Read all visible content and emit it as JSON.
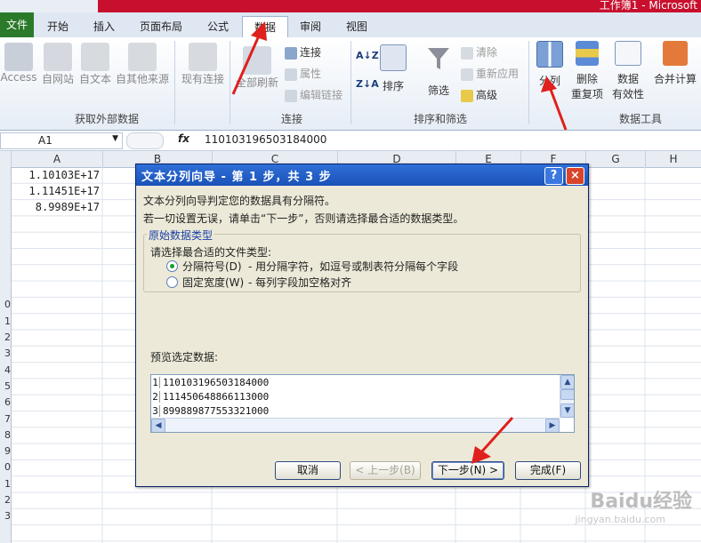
{
  "window": {
    "title_fragment": "工作簿1 - Microsoft"
  },
  "tabs": [
    {
      "label": "文件"
    },
    {
      "label": "开始"
    },
    {
      "label": "插入"
    },
    {
      "label": "页面布局"
    },
    {
      "label": "公式"
    },
    {
      "label": "数据"
    },
    {
      "label": "审阅"
    },
    {
      "label": "视图"
    }
  ],
  "active_tab": "数据",
  "ribbon": {
    "external": {
      "buttons": [
        "Access",
        "自网站",
        "自文本",
        "自其他来源",
        "现有连接"
      ],
      "group_label": "获取外部数据"
    },
    "connections": {
      "refresh_all": "全部刷新",
      "connections": "连接",
      "properties": "属性",
      "edit_links": "编辑链接",
      "group_label": "连接"
    },
    "sort_filter": {
      "sort": "排序",
      "filter": "筛选",
      "clear": "清除",
      "reapply": "重新应用",
      "advanced": "高级",
      "group_label": "排序和筛选"
    },
    "data_tools": {
      "text_to_columns": "分列",
      "remove_duplicates_1": "删除",
      "remove_duplicates_2": "重复项",
      "data_validation_1": "数据",
      "data_validation_2": "有效性",
      "consolidate": "合并计算",
      "group_label": "数据工具"
    }
  },
  "formula_bar": {
    "name_box": "A1",
    "fx": "fx",
    "formula": "110103196503184000"
  },
  "grid": {
    "columns": [
      "A",
      "B",
      "C",
      "D",
      "E",
      "F",
      "G",
      "H"
    ],
    "rows": [
      "",
      "",
      "",
      "",
      "",
      "",
      "",
      "",
      "0",
      "1",
      "2",
      "3",
      "4",
      "5",
      "6",
      "7",
      "8",
      "9",
      "0",
      "1",
      "2",
      "3"
    ],
    "cells": [
      "1.10103E+17",
      "1.11451E+17",
      "8.9989E+17"
    ]
  },
  "dialog": {
    "title": "文本分列向导 - 第 1 步，共 3 步",
    "help": "?",
    "close": "×",
    "line1": "文本分列向导判定您的数据具有分隔符。",
    "line2": "若一切设置无误，请单击“下一步”，否则请选择最合适的数据类型。",
    "group_title": "原始数据类型",
    "prompt": "请选择最合适的文件类型:",
    "options": [
      {
        "label": "分隔符号(D)",
        "desc": "- 用分隔字符，如逗号或制表符分隔每个字段",
        "selected": true
      },
      {
        "label": "固定宽度(W)",
        "desc": "- 每列字段加空格对齐",
        "selected": false
      }
    ],
    "preview_label": "预览选定数据:",
    "preview_rows": [
      {
        "num": "1",
        "text": "110103196503184000"
      },
      {
        "num": "2",
        "text": "111450648866113000"
      },
      {
        "num": "3",
        "text": "899889877553321000"
      },
      {
        "num": "4",
        "text": ""
      }
    ],
    "buttons": {
      "cancel": "取消",
      "back": "< 上一步(B)",
      "next": "下一步(N) >",
      "finish": "完成(F)"
    }
  },
  "watermark": {
    "text": "Baidu经验",
    "url_text": "jingyan.baidu.com"
  },
  "colors": {
    "arrow": "#e0201c",
    "file_tab": "#2a7a2a",
    "dialog_title": "#1a52b8"
  }
}
